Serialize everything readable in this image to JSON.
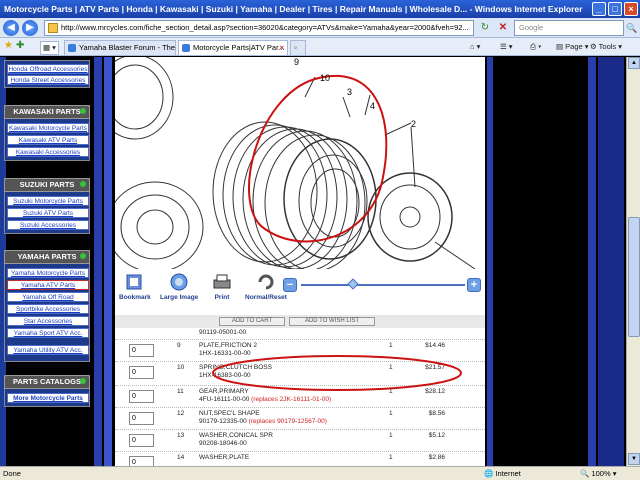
{
  "window": {
    "title": "Motorcycle Parts | ATV Parts | Honda | Kawasaki | Suzuki | Yamaha | Dealer | Tires | Repair Manuals | Wholesale D... - Windows Internet Explorer"
  },
  "address": {
    "url": "http://www.mrcycles.com/fiche_section_detail.asp?section=36020&category=ATVs&make=Yamaha&year=2000&fveh=92...",
    "search_placeholder": "Google"
  },
  "tabs": [
    {
      "label": "Yamaha Blaster Forum - The ..."
    },
    {
      "label": "Motorcycle Parts|ATV Par..."
    }
  ],
  "toolbar": {
    "page_label": "Page",
    "tools_label": "Tools"
  },
  "sidebar": {
    "top_links": [
      "Honda Offroad Accessories",
      "Honda Street Accessories"
    ],
    "sections": [
      {
        "title": "KAWASAKI PARTS",
        "links": [
          "Kawasaki Motorcycle Parts",
          "Kawasaki ATV Parts",
          "Kawasaki Accessories"
        ]
      },
      {
        "title": "SUZUKI PARTS",
        "links": [
          "Suzuki Motorcycle Parts",
          "Suzuki ATV Parts",
          "Suzuki Accessories"
        ]
      },
      {
        "title": "YAMAHA PARTS",
        "links": [
          "Yamaha Motorcycle Parts",
          "Yamaha ATV Parts",
          "Yamaha Off Road",
          "Sportbike Accessories",
          "Star Accessories",
          "Yamaha Sport ATV Acc.",
          "Yamaha Utility ATV Acc."
        ]
      },
      {
        "title": "PARTS CATALOGS",
        "links": [
          "More Motorcycle Parts"
        ]
      }
    ]
  },
  "diagram": {
    "callouts": [
      "9",
      "10",
      "3",
      "4",
      "2"
    ]
  },
  "tools": {
    "bookmark": "Bookmark",
    "large_image": "Large Image",
    "print": "Print",
    "normal_reset": "Normal/Reset",
    "zoom_minus": "−",
    "zoom_plus": "+",
    "zoom_level": 0.32
  },
  "cart": {
    "add_to_cart": "ADD TO CART",
    "add_to_wishlist": "ADD TO WISH LIST"
  },
  "parts": {
    "prev_part_number": "90119-05001-00",
    "rows": [
      {
        "qty_input": "0",
        "ref": "9",
        "desc": "PLATE,FRICTION 2",
        "part": "1HX-16331-00-00",
        "replaces": "",
        "qty": "1",
        "price": "$14.46"
      },
      {
        "qty_input": "0",
        "ref": "10",
        "desc": "SPRING,CLUTCH BOSS",
        "part": "1HX-16383-00-00",
        "replaces": "",
        "qty": "1",
        "price": "$21.57"
      },
      {
        "qty_input": "0",
        "ref": "11",
        "desc": "GEAR,PRIMARY",
        "part": "4FU-16111-00-00",
        "replaces": "(replaces 2JK-16111-01-00)",
        "qty": "1",
        "price": "$28.12"
      },
      {
        "qty_input": "0",
        "ref": "12",
        "desc": "NUT,SPEC'L SHAPE",
        "part": "90179-12335-00",
        "replaces": "(replaces 90179-12567-00)",
        "qty": "1",
        "price": "$8.56"
      },
      {
        "qty_input": "0",
        "ref": "13",
        "desc": "WASHER,CONICAL SPR",
        "part": "90208-18046-00",
        "replaces": "",
        "qty": "1",
        "price": "$5.12"
      },
      {
        "qty_input": "0",
        "ref": "14",
        "desc": "WASHER,PLATE",
        "part": "",
        "replaces": "",
        "qty": "1",
        "price": "$2.86"
      }
    ]
  },
  "status": {
    "left": "Done",
    "zone": "Internet",
    "zoom": "100%"
  },
  "colors": {
    "titlebar": "#2a63d8",
    "sidebar_blue": "#1d3a8a",
    "highlight_red": "#cc1111"
  }
}
